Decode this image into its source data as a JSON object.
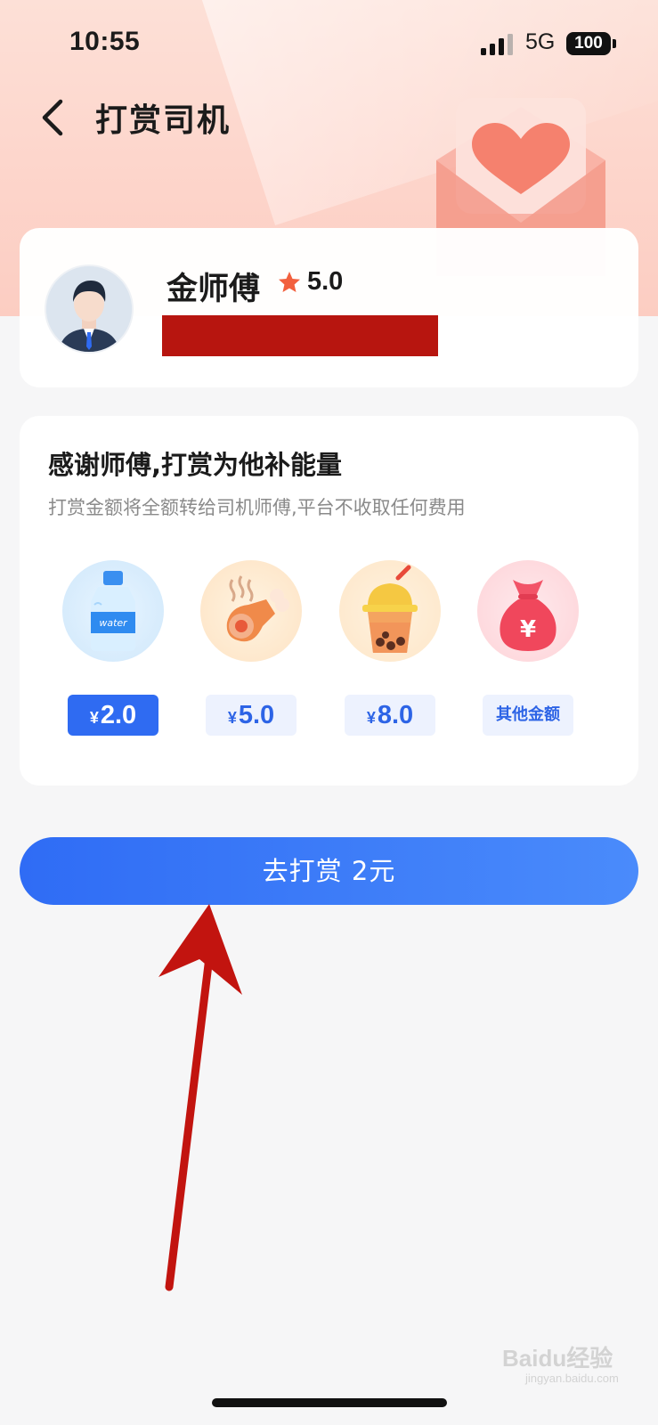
{
  "status_bar": {
    "time": "10:55",
    "network": "5G",
    "battery": "100"
  },
  "header": {
    "title": "打赏司机"
  },
  "driver": {
    "name": "金师傅",
    "rating": "5.0"
  },
  "tip": {
    "title": "感谢师傅,打赏为他补能量",
    "subtitle": "打赏金额将全额转给司机师傅,平台不收取任何费用",
    "options": [
      {
        "icon": "water-bottle-icon",
        "currency": "¥",
        "amount": "2.0",
        "selected": true
      },
      {
        "icon": "chicken-leg-icon",
        "currency": "¥",
        "amount": "5.0",
        "selected": false
      },
      {
        "icon": "bubble-tea-icon",
        "currency": "¥",
        "amount": "8.0",
        "selected": false
      },
      {
        "icon": "money-bag-icon",
        "label": "其他金额",
        "selected": false
      }
    ]
  },
  "submit": {
    "label": "去打赏 2元"
  },
  "watermark": {
    "text": "Baidu经验",
    "sub": "jingyan.baidu.com"
  },
  "colors": {
    "primary": "#2f6bf2",
    "header_bg": "#fdd5cb",
    "redaction": "#b7150f",
    "star": "#f2603e"
  }
}
